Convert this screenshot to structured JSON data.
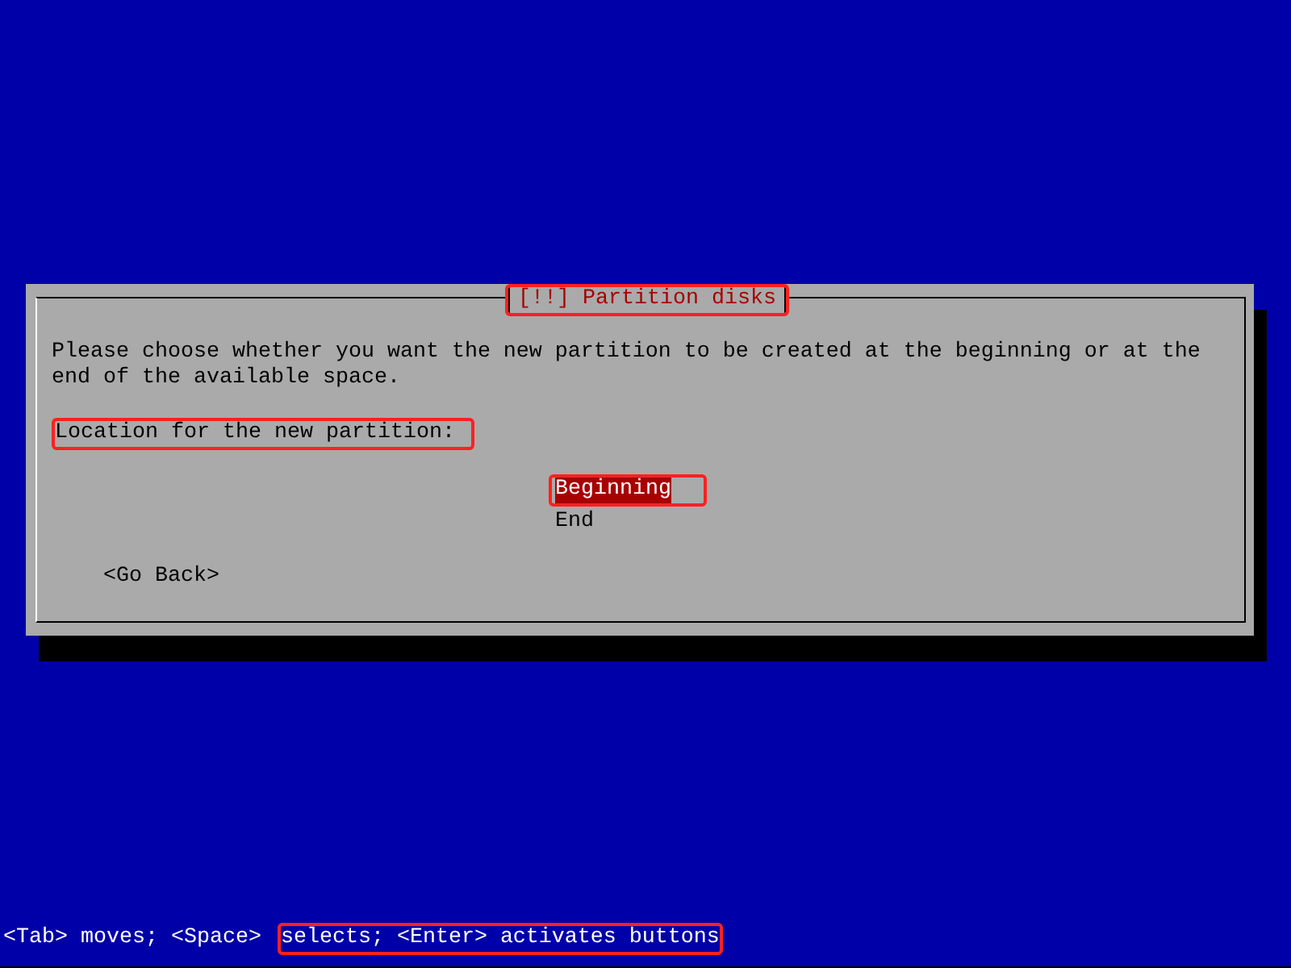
{
  "dialog": {
    "title": "[!!] Partition disks",
    "title_highlighted": true,
    "message": "Please choose whether you want the new partition to be created at the beginning or at the end of the available space.",
    "prompt": "Location for the new partition:",
    "prompt_highlighted": true,
    "options": [
      {
        "label": "Beginning",
        "selected": true,
        "highlighted": true
      },
      {
        "label": "End",
        "selected": false,
        "highlighted": false
      }
    ],
    "back_button": "<Go Back>"
  },
  "status_bar": [
    {
      "text": "<Tab> moves; <Space>",
      "highlighted": false
    },
    {
      "text": "selects; <Enter> activates buttons",
      "highlighted": true
    }
  ]
}
